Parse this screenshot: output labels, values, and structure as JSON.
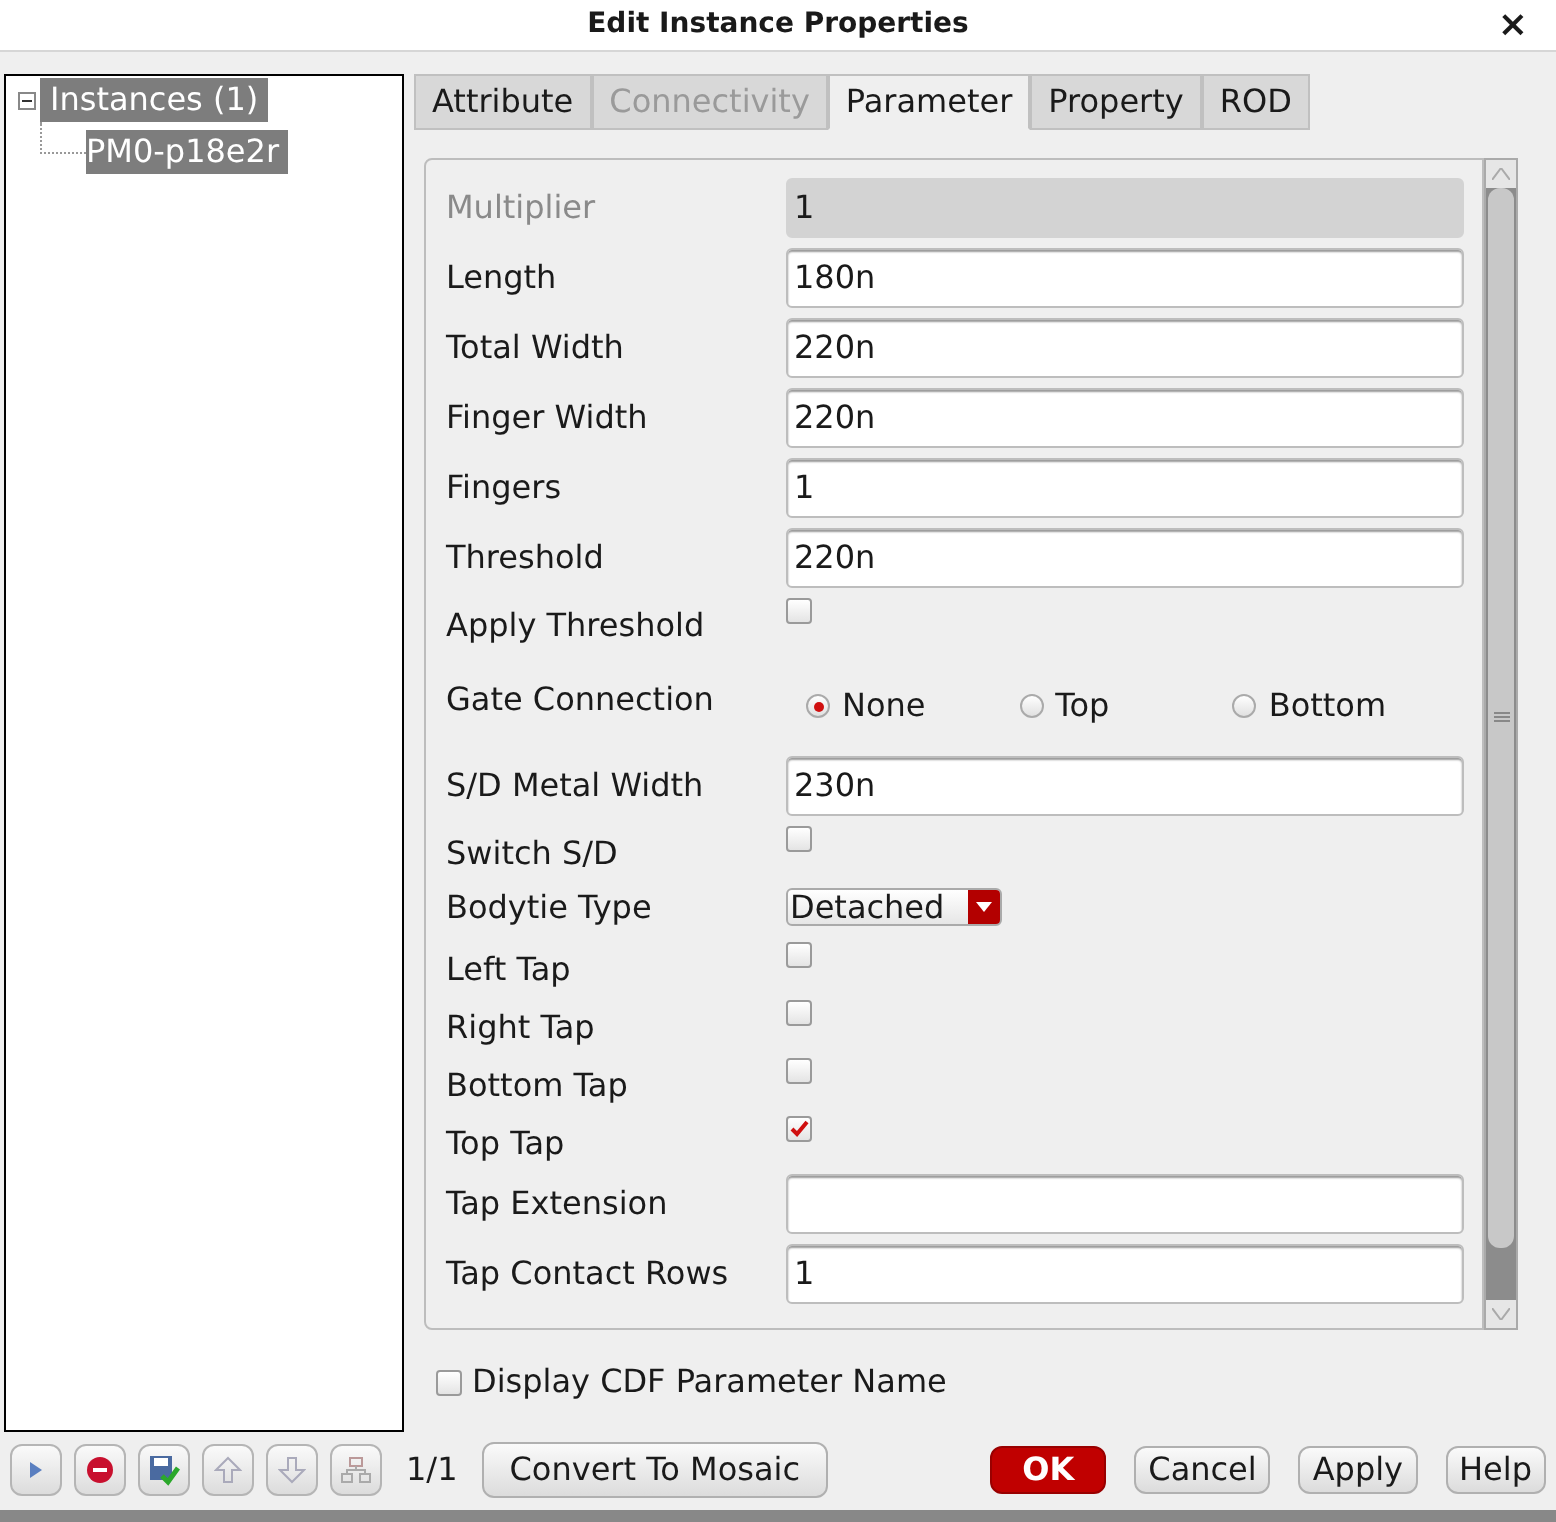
{
  "window": {
    "title": "Edit Instance Properties",
    "close": "×"
  },
  "tree": {
    "label": "Instances (1)",
    "expanded": true,
    "selected": true,
    "children": [
      {
        "label": "PM0-p18e2r",
        "selected": true
      }
    ]
  },
  "tabs": [
    {
      "label": "Attribute",
      "selected": false,
      "disabled": false
    },
    {
      "label": "Connectivity",
      "selected": false,
      "disabled": true
    },
    {
      "label": "Parameter",
      "selected": true,
      "disabled": false
    },
    {
      "label": "Property",
      "selected": false,
      "disabled": false
    },
    {
      "label": "ROD",
      "selected": false,
      "disabled": false
    }
  ],
  "parameters": [
    {
      "kind": "field",
      "label": "Multiplier",
      "value": "1",
      "disabled": true
    },
    {
      "kind": "field",
      "label": "Length",
      "value": "180n",
      "disabled": false
    },
    {
      "kind": "field",
      "label": "Total Width",
      "value": "220n",
      "disabled": false
    },
    {
      "kind": "field",
      "label": "Finger Width",
      "value": "220n",
      "disabled": false
    },
    {
      "kind": "field",
      "label": "Fingers",
      "value": "1",
      "disabled": false
    },
    {
      "kind": "field",
      "label": "Threshold",
      "value": "220n",
      "disabled": false
    },
    {
      "kind": "checkbox",
      "label": "Apply Threshold",
      "checked": false
    },
    {
      "kind": "radio",
      "label": "Gate Connection",
      "options": [
        {
          "label": "None",
          "selected": true
        },
        {
          "label": "Top",
          "selected": false
        },
        {
          "label": "Bottom",
          "selected": false
        }
      ]
    },
    {
      "kind": "field",
      "label": "S/D Metal Width",
      "value": "230n",
      "disabled": false
    },
    {
      "kind": "checkbox",
      "label": "Switch S/D",
      "checked": false
    },
    {
      "kind": "dropdown",
      "label": "Bodytie Type",
      "value": "Detached"
    },
    {
      "kind": "checkbox",
      "label": "Left Tap",
      "checked": false
    },
    {
      "kind": "checkbox",
      "label": "Right Tap",
      "checked": false
    },
    {
      "kind": "checkbox",
      "label": "Bottom Tap",
      "checked": false
    },
    {
      "kind": "checkbox",
      "label": "Top Tap",
      "checked": true
    },
    {
      "kind": "field",
      "label": "Tap Extension",
      "disabled": false
    },
    {
      "kind": "field",
      "label": "Tap Contact Rows",
      "value": "1",
      "disabled": false
    }
  ],
  "display_cdf": {
    "label": "Display CDF Parameter Name",
    "checked": false
  },
  "footer": {
    "count": "1/1",
    "convert": "Convert To Mosaic",
    "buttons": [
      {
        "label": "OK",
        "kind": "primary"
      },
      {
        "label": "Cancel",
        "kind": "normal"
      },
      {
        "label": "Apply",
        "kind": "normal"
      },
      {
        "label": "Help",
        "kind": "normal"
      }
    ]
  }
}
